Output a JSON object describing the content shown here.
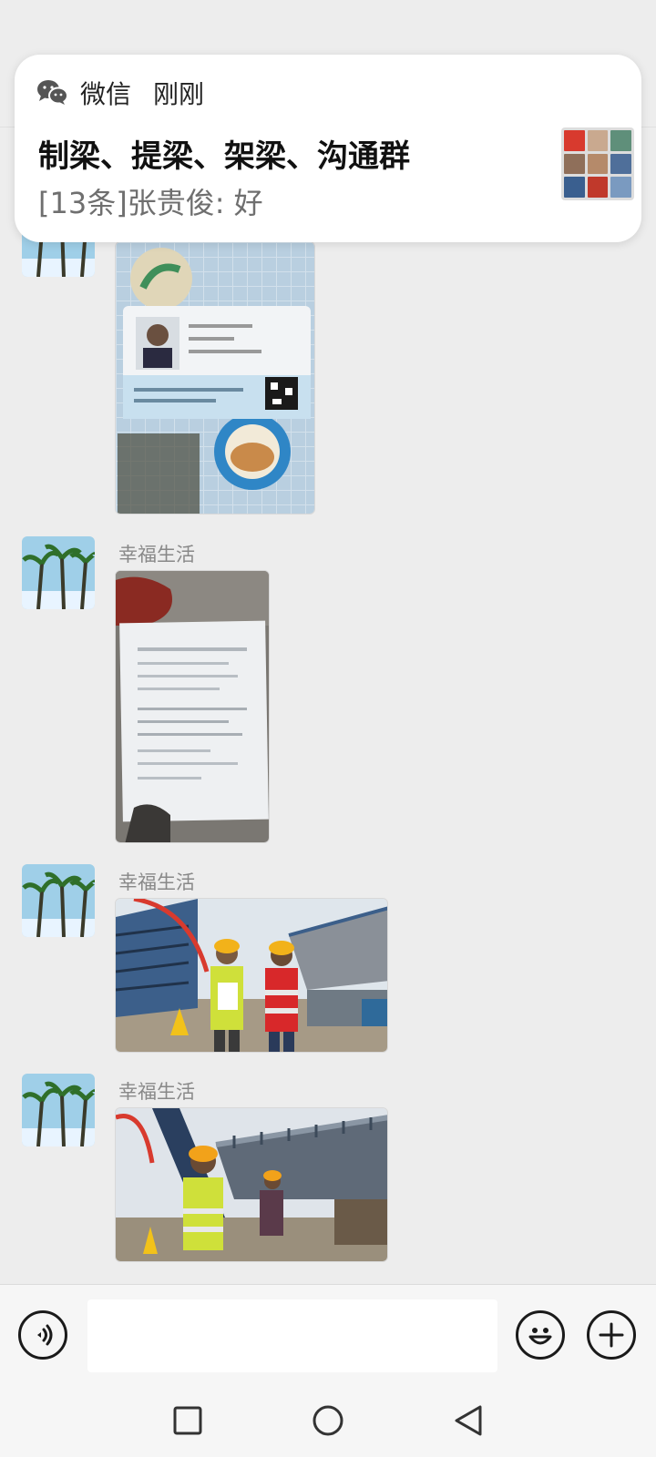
{
  "notification": {
    "app_name": "微信",
    "time": "刚刚",
    "title": "制梁、提梁、架梁、沟通群",
    "preview": "[13条]张贵俊: 好",
    "group_avatar_colors": [
      "#d83a2e",
      "#c9a98f",
      "#5f8f7a",
      "#8f6f5a",
      "#b58a6a",
      "#4f6f9a",
      "#3a5f8f",
      "#c0392b",
      "#7a9ac0"
    ]
  },
  "messages": [
    {
      "sender": "",
      "image": "id-card-photo"
    },
    {
      "sender": "幸福生活",
      "image": "handheld-document-photo"
    },
    {
      "sender": "幸福生活",
      "image": "workers-site-photo"
    },
    {
      "sender": "幸福生活",
      "image": "bridge-site-photo"
    }
  ],
  "input": {
    "value": "",
    "placeholder": ""
  },
  "icons": {
    "voice": "voice-input-icon",
    "emoji": "emoji-icon",
    "more": "plus-icon",
    "nav_recent": "square-icon",
    "nav_home": "circle-icon",
    "nav_back": "triangle-back-icon",
    "wechat": "wechat-icon"
  },
  "colors": {
    "chat_bg": "#ededed",
    "banner_bg": "#ffffff",
    "sender_text": "#888888",
    "preview_text": "#6f6f6f"
  }
}
